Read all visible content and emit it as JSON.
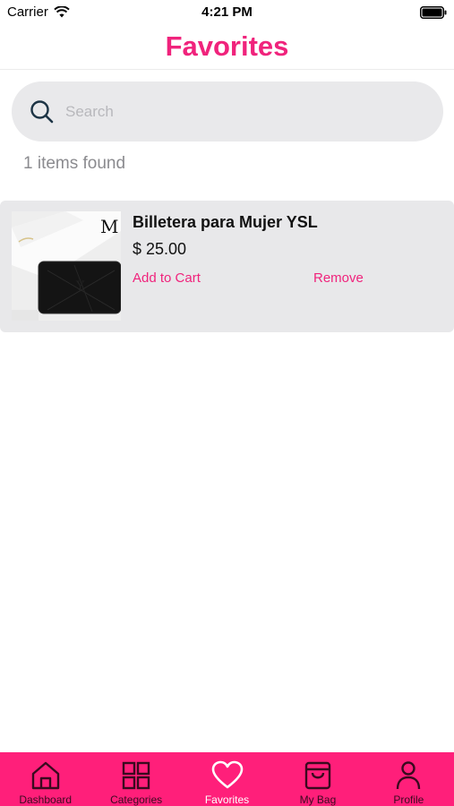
{
  "status_bar": {
    "carrier": "Carrier",
    "time": "4:21 PM"
  },
  "header": {
    "title": "Favorites"
  },
  "search": {
    "placeholder": "Search",
    "value": "",
    "icon": "search-icon"
  },
  "results": {
    "count_text": "1 items found"
  },
  "items": [
    {
      "name": "Billetera para Mujer YSL",
      "price": "$ 25.00",
      "add_to_cart_label": "Add to Cart",
      "remove_label": "Remove",
      "thumbnail_letter": "M"
    }
  ],
  "tab_bar": {
    "items": [
      {
        "label": "Dashboard",
        "icon": "home-icon"
      },
      {
        "label": "Categories",
        "icon": "grid-icon"
      },
      {
        "label": "Favorites",
        "icon": "heart-icon",
        "active": true
      },
      {
        "label": "My Bag",
        "icon": "bag-icon"
      },
      {
        "label": "Profile",
        "icon": "person-icon"
      }
    ]
  },
  "colors": {
    "accent": "#f0237c",
    "tab_bar": "#ff1f7a",
    "card": "#e8e8ea"
  }
}
